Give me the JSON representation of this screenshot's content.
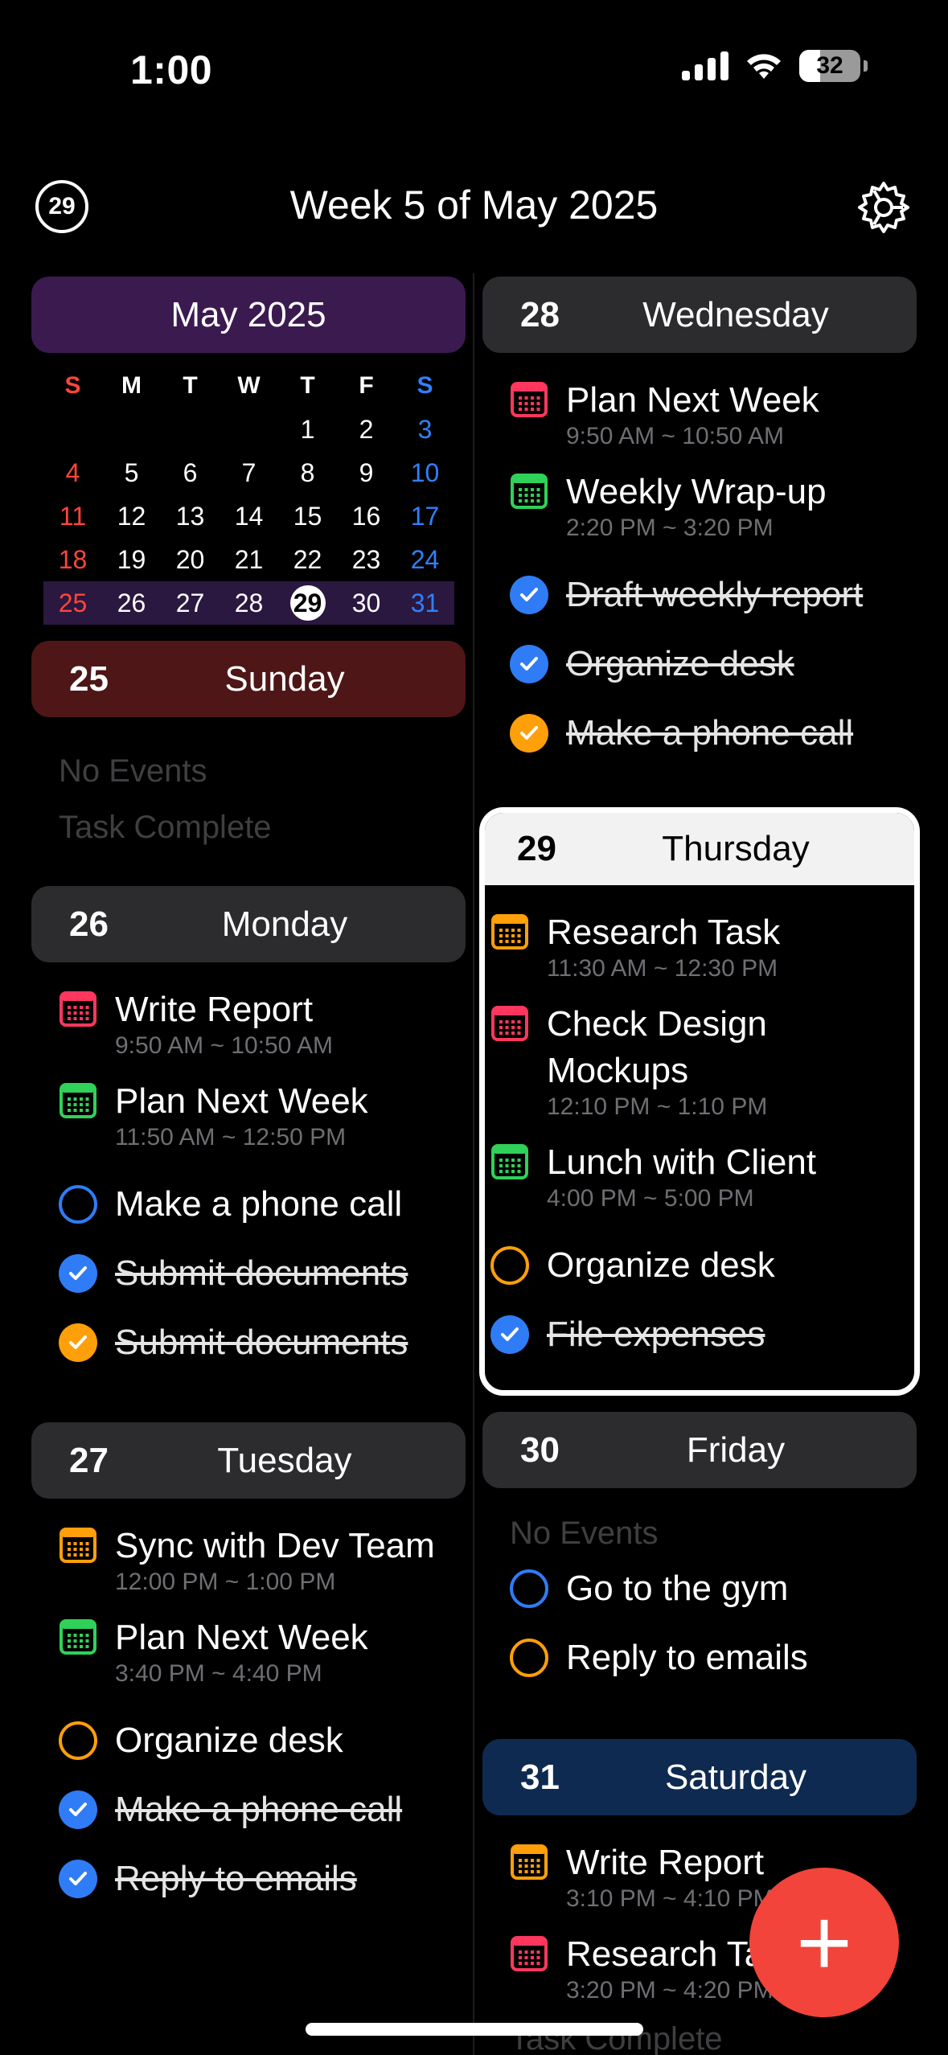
{
  "status": {
    "time": "1:00",
    "battery": "32"
  },
  "header": {
    "today_num": "29",
    "title": "Week 5 of May 2025"
  },
  "mini_cal": {
    "title": "May 2025",
    "weekdays": [
      "S",
      "M",
      "T",
      "W",
      "T",
      "F",
      "S"
    ],
    "weeks": [
      [
        "",
        "",
        "",
        "",
        "1",
        "2",
        "3"
      ],
      [
        "4",
        "5",
        "6",
        "7",
        "8",
        "9",
        "10"
      ],
      [
        "11",
        "12",
        "13",
        "14",
        "15",
        "16",
        "17"
      ],
      [
        "18",
        "19",
        "20",
        "21",
        "22",
        "23",
        "24"
      ],
      [
        "25",
        "26",
        "27",
        "28",
        "29",
        "30",
        "31"
      ]
    ],
    "today": "29"
  },
  "days": {
    "sun": {
      "num": "25",
      "name": "Sunday",
      "no_events": "No Events",
      "task_complete": "Task Complete"
    },
    "mon": {
      "num": "26",
      "name": "Monday",
      "events": [
        {
          "title": "Write Report",
          "time": "9:50 AM ~ 10:50 AM",
          "color": "#ff375f"
        },
        {
          "title": "Plan Next Week",
          "time": "11:50 AM ~ 12:50 PM",
          "color": "#30d158"
        }
      ],
      "tasks": [
        {
          "title": "Make a phone call",
          "done": false,
          "color": "blue"
        },
        {
          "title": "Submit documents",
          "done": true,
          "color": "blue"
        },
        {
          "title": "Submit documents",
          "done": true,
          "color": "orange"
        }
      ]
    },
    "tue": {
      "num": "27",
      "name": "Tuesday",
      "events": [
        {
          "title": "Sync with Dev Team",
          "time": "12:00 PM ~ 1:00 PM",
          "color": "#ff9f0a"
        },
        {
          "title": "Plan Next Week",
          "time": "3:40 PM ~ 4:40 PM",
          "color": "#30d158"
        }
      ],
      "tasks": [
        {
          "title": "Organize desk",
          "done": false,
          "color": "orange"
        },
        {
          "title": "Make a phone call",
          "done": true,
          "color": "blue"
        },
        {
          "title": "Reply to emails",
          "done": true,
          "color": "blue"
        }
      ]
    },
    "wed": {
      "num": "28",
      "name": "Wednesday",
      "events": [
        {
          "title": "Plan Next Week",
          "time": "9:50 AM ~ 10:50 AM",
          "color": "#ff375f"
        },
        {
          "title": "Weekly Wrap-up",
          "time": "2:20 PM ~ 3:20 PM",
          "color": "#30d158"
        }
      ],
      "tasks": [
        {
          "title": "Draft weekly report",
          "done": true,
          "color": "blue"
        },
        {
          "title": "Organize desk",
          "done": true,
          "color": "blue"
        },
        {
          "title": "Make a phone call",
          "done": true,
          "color": "orange"
        }
      ]
    },
    "thu": {
      "num": "29",
      "name": "Thursday",
      "events": [
        {
          "title": "Research Task",
          "time": "11:30 AM ~ 12:30 PM",
          "color": "#ff9f0a"
        },
        {
          "title": "Check Design Mockups",
          "time": "12:10 PM ~ 1:10 PM",
          "color": "#ff375f"
        },
        {
          "title": "Lunch with Client",
          "time": "4:00 PM ~ 5:00 PM",
          "color": "#30d158"
        }
      ],
      "tasks": [
        {
          "title": "Organize desk",
          "done": false,
          "color": "orange"
        },
        {
          "title": "File expenses",
          "done": true,
          "color": "blue"
        }
      ]
    },
    "fri": {
      "num": "30",
      "name": "Friday",
      "no_events": "No Events",
      "tasks": [
        {
          "title": "Go to the gym",
          "done": false,
          "color": "blue"
        },
        {
          "title": "Reply to emails",
          "done": false,
          "color": "orange"
        }
      ]
    },
    "sat": {
      "num": "31",
      "name": "Saturday",
      "events": [
        {
          "title": "Write Report",
          "time": "3:10 PM ~ 4:10 PM",
          "color": "#ff9f0a"
        },
        {
          "title": "Research Task",
          "time": "3:20 PM ~ 4:20 PM",
          "color": "#ff375f"
        }
      ],
      "task_complete": "Task Complete"
    }
  },
  "fab": {
    "label": "+"
  }
}
